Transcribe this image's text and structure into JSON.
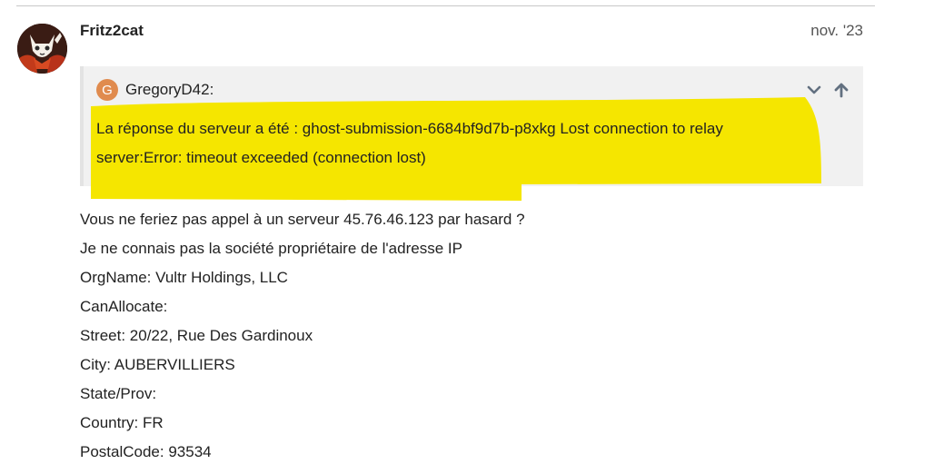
{
  "post": {
    "username": "Fritz2cat",
    "date": "nov. '23"
  },
  "quote": {
    "author_initial": "G",
    "author": "GregoryD42:",
    "text_line1": "La réponse du serveur a été : ghost-submission-6684bf9d7b-p8xkg Lost connection to relay",
    "text_line2": "server:Error: timeout exceeded (connection lost)",
    "avatar_color": "#e08b4e",
    "highlight_color": "#f5e600"
  },
  "body": {
    "lines": [
      "Vous ne feriez pas appel à un serveur 45.76.46.123 par hasard ?",
      "Je ne connais pas la société propriétaire de l'adresse IP",
      "OrgName: Vultr Holdings, LLC",
      "CanAllocate:",
      "Street: 20/22, Rue Des Gardinoux",
      "City: AUBERVILLIERS",
      "State/Prov:",
      "Country: FR",
      "PostalCode: 93534"
    ]
  },
  "icons": {
    "expand": "chevron-down-icon",
    "go_to_quoted": "arrow-up-icon",
    "user": "avatar-cat-icon"
  }
}
